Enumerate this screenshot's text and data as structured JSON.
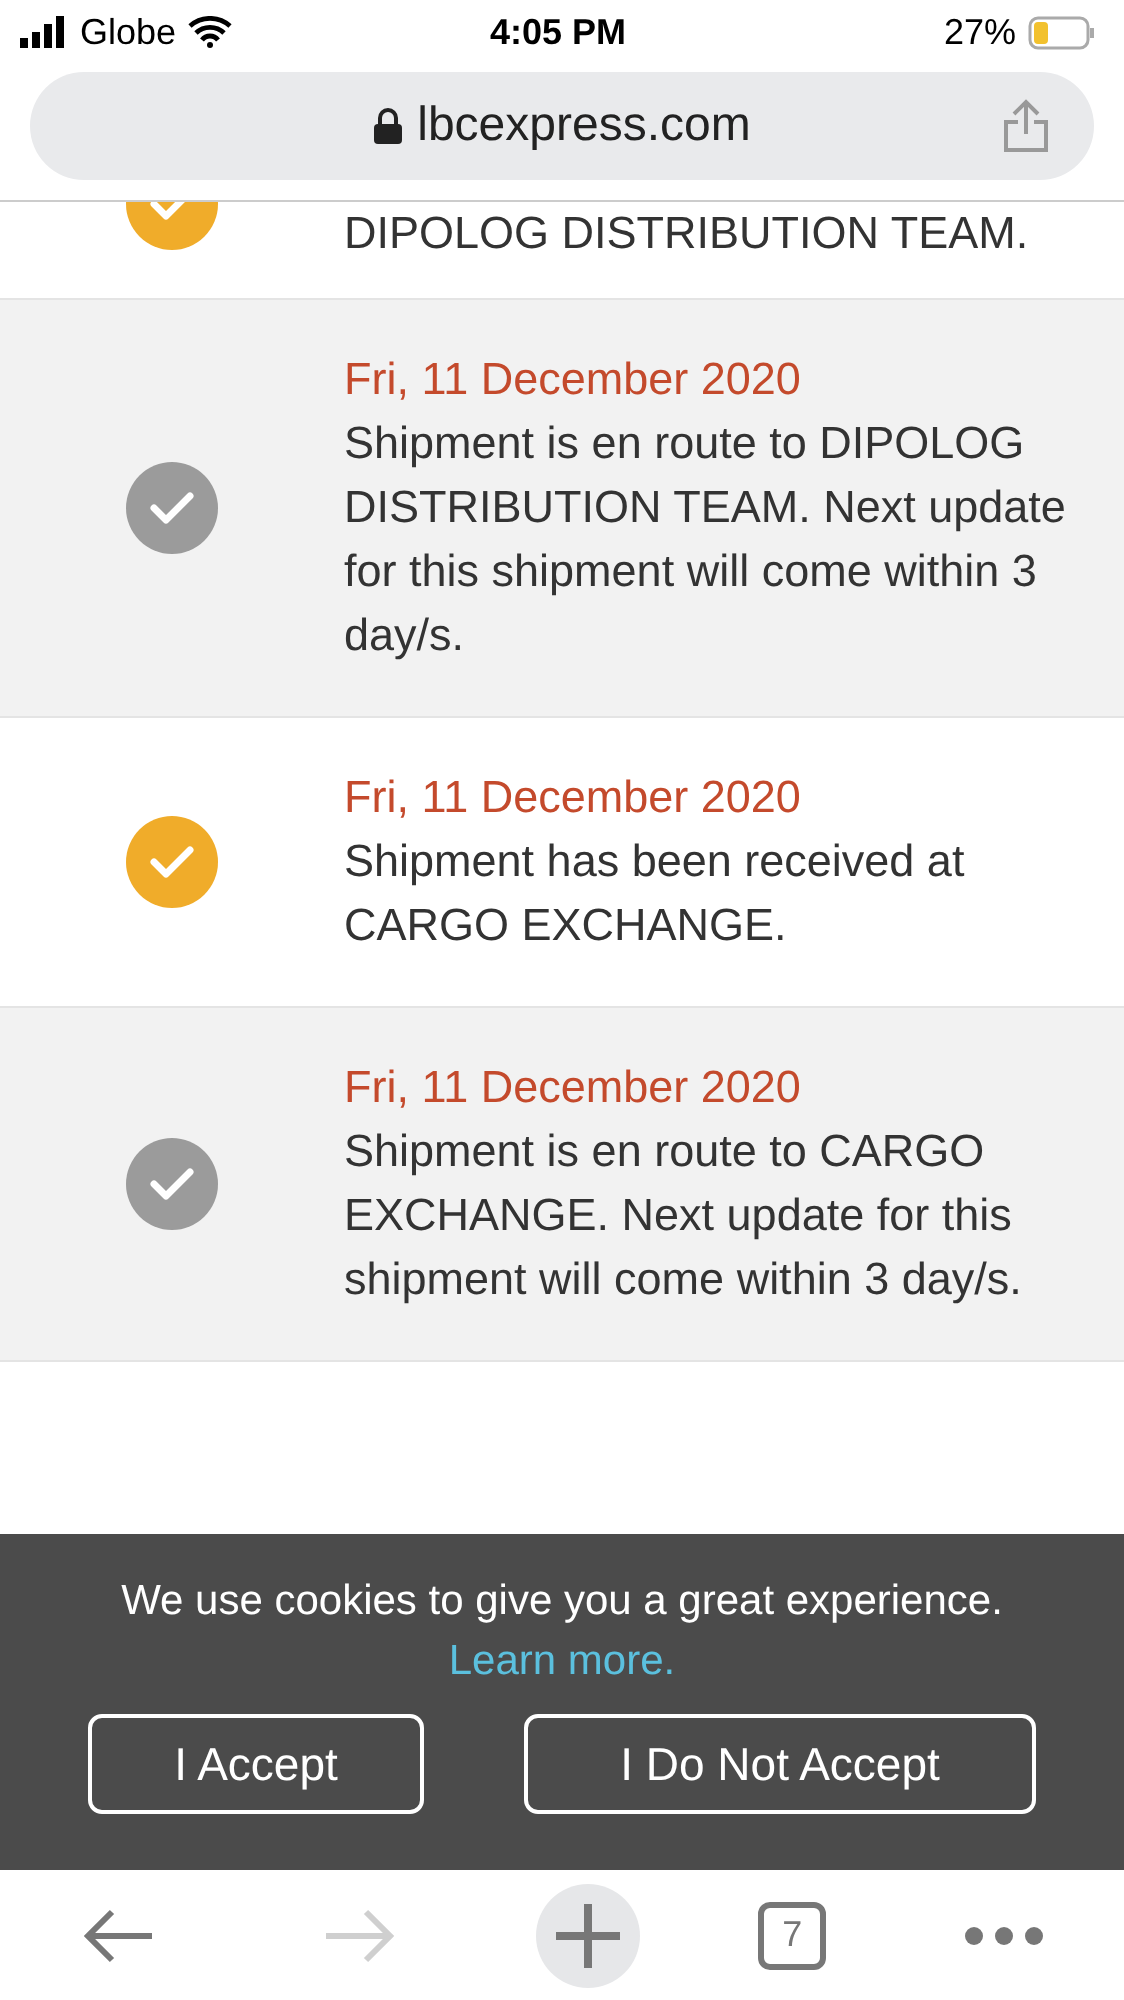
{
  "status_bar": {
    "carrier": "Globe",
    "time": "4:05 PM",
    "battery": "27%"
  },
  "address_bar": {
    "url": "lbcexpress.com"
  },
  "entries": [
    {
      "text": "DIPOLOG DISTRIBUTION TEAM.",
      "color": "#f0ac2a",
      "shaded": false
    },
    {
      "date": "Fri, 11 December 2020",
      "text": "Shipment is en route to DIPOLOG DISTRIBUTION TEAM. Next update for this shipment will come within 3 day/s.",
      "color": "#9b9b9b",
      "shaded": true
    },
    {
      "date": "Fri, 11 December 2020",
      "text": "Shipment has been received at CARGO EXCHANGE.",
      "color": "#f0ac2a",
      "shaded": false
    },
    {
      "date": "Fri, 11 December 2020",
      "text": "Shipment is en route to CARGO EXCHANGE. Next update for this shipment will come within 3 day/s.",
      "color": "#9b9b9b",
      "shaded": true
    }
  ],
  "cookie_banner": {
    "message": "We use cookies to give you a great experience.",
    "link": "Learn more.",
    "buttons": [
      "I Accept",
      "I Do Not Accept"
    ]
  },
  "toolbar": [
    {
      "kind": "back",
      "disabled": false
    },
    {
      "kind": "forward",
      "disabled": true
    },
    {
      "kind": "new_tab",
      "disabled": false
    },
    {
      "kind": "tabs",
      "label": "7",
      "disabled": false
    },
    {
      "kind": "more",
      "disabled": false
    }
  ]
}
